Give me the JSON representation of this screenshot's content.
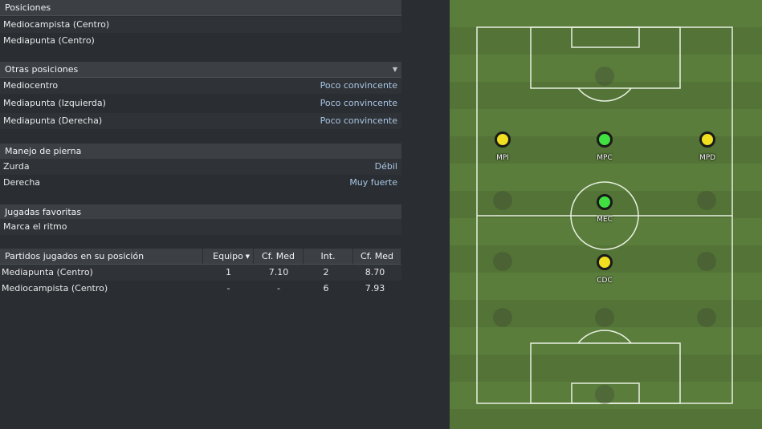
{
  "positions": {
    "header": "Posiciones",
    "items": [
      "Mediocampista (Centro)",
      "Mediapunta (Centro)"
    ]
  },
  "other_positions": {
    "header": "Otras posiciones",
    "items": [
      {
        "label": "Mediocentro",
        "value": "Poco convincente"
      },
      {
        "label": "Mediapunta (Izquierda)",
        "value": "Poco convincente"
      },
      {
        "label": "Mediapunta (Derecha)",
        "value": "Poco convincente"
      }
    ]
  },
  "footedness": {
    "header": "Manejo de pierna",
    "items": [
      {
        "label": "Zurda",
        "value": "Débil"
      },
      {
        "label": "Derecha",
        "value": "Muy fuerte"
      }
    ]
  },
  "favorite_moves": {
    "header": "Jugadas favoritas",
    "items": [
      "Marca el ritmo"
    ]
  },
  "matches_table": {
    "columns": [
      "Partidos jugados en su posición",
      "Equipo",
      "Cf. Med",
      "Int.",
      "Cf. Med"
    ],
    "rows": [
      [
        "Mediapunta (Centro)",
        "1",
        "7.10",
        "2",
        "8.70"
      ],
      [
        "Mediocampista (Centro)",
        "-",
        "-",
        "6",
        "7.93"
      ]
    ]
  },
  "pitch": {
    "players": [
      {
        "label": "MPI",
        "color": "#f0e020"
      },
      {
        "label": "MPC",
        "color": "#40e040"
      },
      {
        "label": "MPD",
        "color": "#f0e020"
      },
      {
        "label": "MEC",
        "color": "#40e040"
      },
      {
        "label": "CDC",
        "color": "#f0e020"
      }
    ]
  }
}
